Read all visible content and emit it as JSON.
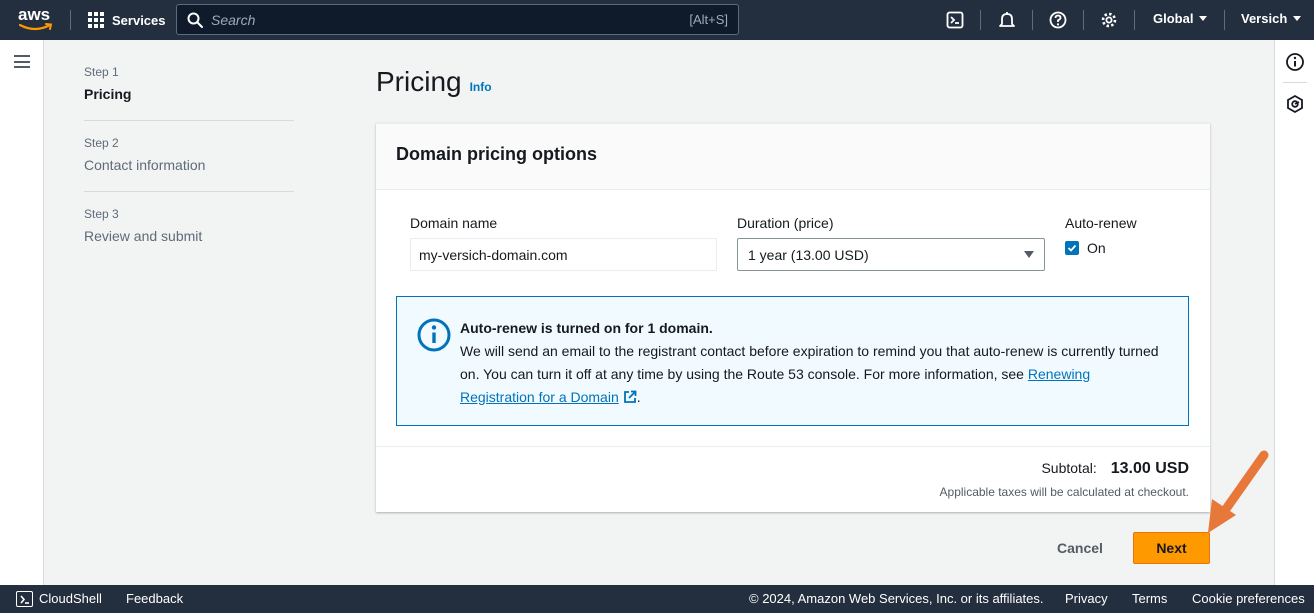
{
  "nav": {
    "logo": "aws",
    "services": "Services",
    "search_placeholder": "Search",
    "search_shortcut": "[Alt+S]",
    "region": "Global",
    "account": "Versich"
  },
  "steps": [
    {
      "no": "Step 1",
      "name": "Pricing"
    },
    {
      "no": "Step 2",
      "name": "Contact information"
    },
    {
      "no": "Step 3",
      "name": "Review and submit"
    }
  ],
  "page": {
    "title": "Pricing",
    "info": "Info"
  },
  "card": {
    "header": "Domain pricing options",
    "domain_label": "Domain name",
    "domain_value": "my-versich-domain.com",
    "duration_label": "Duration (price)",
    "duration_value": "1 year (13.00 USD)",
    "autorenew_label": "Auto-renew",
    "autorenew_value": "On"
  },
  "alert": {
    "title": "Auto-renew is turned on for 1 domain.",
    "body": "We will send an email to the registrant contact before expiration to remind you that auto-renew is currently turned on. You can turn it off at any time by using the Route 53 console. For more information, see ",
    "link": "Renewing Registration for a Domain",
    "end": "."
  },
  "summary": {
    "subtotal_label": "Subtotal:",
    "subtotal_value": "13.00 USD",
    "tax_note": "Applicable taxes will be calculated at checkout."
  },
  "actions": {
    "cancel": "Cancel",
    "next": "Next"
  },
  "footer": {
    "cloudshell": "CloudShell",
    "feedback": "Feedback",
    "copyright": "© 2024, Amazon Web Services, Inc. or its affiliates.",
    "privacy": "Privacy",
    "terms": "Terms",
    "cookies": "Cookie preferences"
  },
  "colors": {
    "nav_bg": "#232f3e",
    "primary": "#ff9900",
    "link": "#0073bb",
    "annotation_arrow": "#e8773a"
  }
}
